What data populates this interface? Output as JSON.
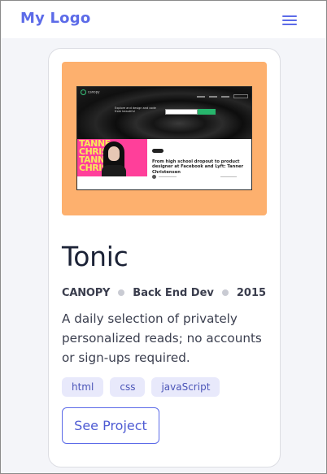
{
  "header": {
    "logo_text": "My Logo",
    "menu_icon": "hamburger-menu-icon",
    "accent_color": "#5c6be8"
  },
  "project": {
    "preview": {
      "background_color": "#fdb06e",
      "site_brand": "canopy",
      "site_tagline": "Explore and design and code from beautiful",
      "photo_word": "TANNE",
      "photo_word_2": "CHRIS",
      "headline": "From high school dropout to product designer at Facebook and Lyft: Tanner Christensen"
    },
    "title": "Tonic",
    "client": "CANOPY",
    "role": "Back End Dev",
    "year": "2015",
    "description": "A daily selection of privately personalized reads; no accounts or sign-ups required.",
    "tags": [
      "html",
      "css",
      "javaScript"
    ],
    "button_label": "See Project"
  }
}
